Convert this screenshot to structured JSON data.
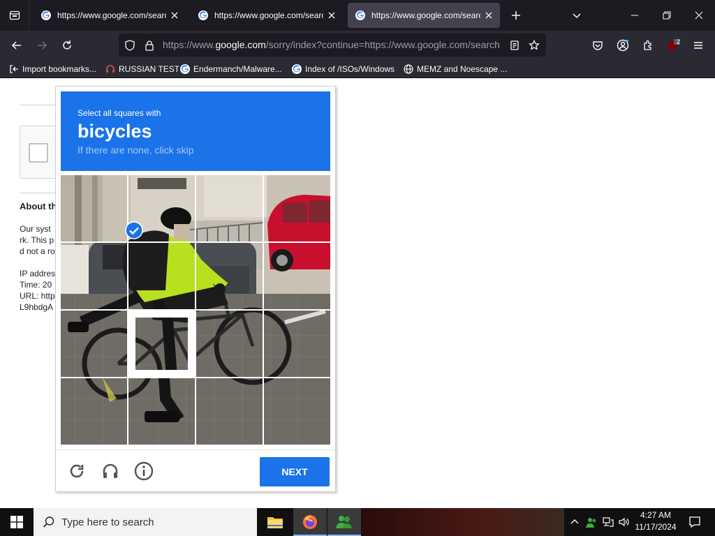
{
  "browser": {
    "tabs": [
      {
        "title": "https://www.google.com/search",
        "active": false
      },
      {
        "title": "https://www.google.com/search",
        "active": false
      },
      {
        "title": "https://www.google.com/search",
        "active": true
      }
    ],
    "url": {
      "prefix": "https://www.",
      "domain": "google.com",
      "rest": "/sorry/index?continue=https://www.google.com/search"
    },
    "extension_badge": "2",
    "bookmarks": [
      {
        "label": "Import bookmarks...",
        "icon": "import-icon"
      },
      {
        "label": "RUSSIAN TEST",
        "icon": "headphones-favicon"
      },
      {
        "label": "Endermanch/Malware...",
        "icon": "google-favicon"
      },
      {
        "label": "Index of /ISOs/Windows",
        "icon": "google-favicon"
      },
      {
        "label": "MEMZ and Noescape ...",
        "icon": "globe-icon"
      }
    ]
  },
  "page": {
    "about_heading": "About th",
    "para_lines": [
      "Our syst",
      "rk. This p",
      "d not a ro"
    ],
    "info_lines": [
      "IP addres",
      "Time: 20",
      "URL: http",
      "L9hbdgA"
    ]
  },
  "captcha": {
    "instruction": "Select all squares with",
    "target": "bicycles",
    "subtext": "If there are none, click skip",
    "selected_tile": 9,
    "next_label": "NEXT",
    "accent": "#1a73e8"
  },
  "taskbar": {
    "search_placeholder": "Type here to search",
    "time": "4:27 AM",
    "date": "11/17/2024"
  }
}
